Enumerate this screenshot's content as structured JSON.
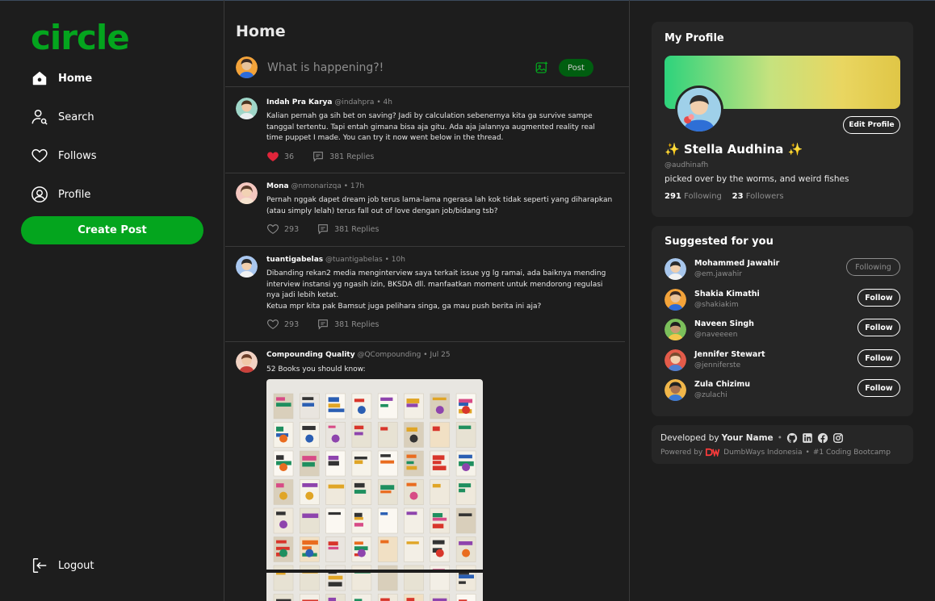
{
  "app": {
    "logo": "circle"
  },
  "nav": {
    "home": "Home",
    "search": "Search",
    "follows": "Follows",
    "profile": "Profile",
    "create_post": "Create Post",
    "logout": "Logout"
  },
  "feed": {
    "title": "Home",
    "composer": {
      "placeholder": "What is happening?!",
      "post_label": "Post"
    },
    "posts": [
      {
        "name": "Indah Pra Karya",
        "handle": "@indahpra",
        "sep": "•",
        "time": "4h",
        "text": "Kalian pernah ga sih bet on saving? Jadi by calculation sebenernya kita ga survive sampe tanggal tertentu. Tapi entah gimana bisa aja gitu. Ada aja jalannya augmented reality real time puppet I made. You can try it now went below in the thread.",
        "likes": "36",
        "replies": "381 Replies",
        "liked": true
      },
      {
        "name": "Mona",
        "handle": "@nmonarizqa",
        "sep": "•",
        "time": "17h",
        "text": "Pernah nggak dapet dream job terus lama-lama ngerasa lah kok tidak seperti yang diharapkan (atau simply lelah) terus fall out of love dengan job/bidang tsb?",
        "likes": "293",
        "replies": "381 Replies",
        "liked": false
      },
      {
        "name": "tuantigabelas",
        "handle": "@tuantigabelas",
        "sep": "•",
        "time": "10h",
        "text": "Dibanding rekan2 media menginterview saya terkait issue yg lg ramai, ada baiknya mending interview instansi yg ngasih izin, BKSDA dll. manfaatkan moment untuk mendorong regulasi nya jadi lebih ketat.",
        "text2": "Ketua mpr kita pak Bamsut juga pelihara singa, ga mau push berita ini aja?",
        "likes": "293",
        "replies": "381 Replies",
        "liked": false
      },
      {
        "name": "Compounding Quality",
        "handle": "@QCompounding",
        "sep": "•",
        "time": "Jul 25",
        "text": "52 Books you should know:"
      }
    ]
  },
  "profile_card": {
    "title": "My Profile",
    "edit_label": "Edit Profile",
    "name": "✨ Stella Audhina ✨",
    "handle": "@audhinafh",
    "bio": "picked over by the worms, and weird fishes",
    "following_count": "291",
    "following_label": "Following",
    "followers_count": "23",
    "followers_label": "Followers"
  },
  "suggested": {
    "title": "Suggested for you",
    "users": [
      {
        "name": "Mohammed Jawahir",
        "handle": "@em.jawahir",
        "button": "Following",
        "following": true
      },
      {
        "name": "Shakia Kimathi",
        "handle": "@shakiakim",
        "button": "Follow",
        "following": false
      },
      {
        "name": "Naveen Singh",
        "handle": "@naveeeen",
        "button": "Follow",
        "following": false
      },
      {
        "name": "Jennifer Stewart",
        "handle": "@jenniferste",
        "button": "Follow",
        "following": false
      },
      {
        "name": "Zula Chizimu",
        "handle": "@zulachi",
        "button": "Follow",
        "following": false
      }
    ]
  },
  "footer": {
    "developed_by": "Developed by",
    "your_name": "Your Name",
    "dot": "•",
    "powered_by": "Powered by",
    "company": "DumbWays Indonesia",
    "tagline": "#1 Coding Bootcamp"
  },
  "colors": {
    "accent": "#04a51e",
    "background": "#1d1d1d",
    "card": "#262626",
    "like": "#e0253a"
  }
}
